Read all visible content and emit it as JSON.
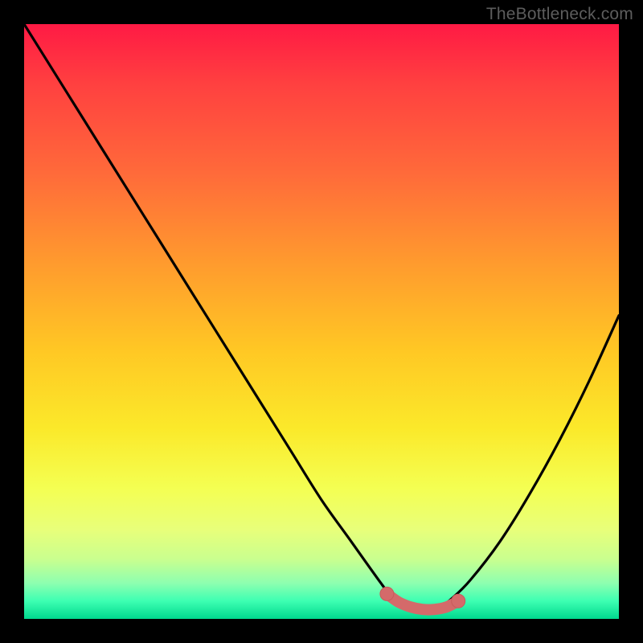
{
  "watermark": "TheBottleneck.com",
  "colors": {
    "curve": "#000000",
    "marker_fill": "#d46a6a",
    "marker_stroke": "#c85a5a",
    "gradient_top": "#ff1a44",
    "gradient_bottom": "#00d88e",
    "frame": "#000000"
  },
  "chart_data": {
    "type": "line",
    "title": "",
    "xlabel": "",
    "ylabel": "",
    "xlim": [
      0,
      100
    ],
    "ylim": [
      0,
      100
    ],
    "series": [
      {
        "name": "bottleneck-curve",
        "x": [
          0,
          5,
          10,
          15,
          20,
          25,
          30,
          35,
          40,
          45,
          50,
          55,
          60,
          62,
          64,
          66,
          68,
          70,
          72,
          75,
          80,
          85,
          90,
          95,
          100
        ],
        "values": [
          100,
          92,
          84,
          76,
          68,
          60,
          52,
          44,
          36,
          28,
          20,
          13,
          6,
          3.5,
          2,
          1.5,
          1.5,
          2,
          3.5,
          6.5,
          13,
          21,
          30,
          40,
          51
        ]
      }
    ],
    "markers": {
      "name": "optimal-range",
      "x": [
        61,
        63,
        65,
        67,
        69,
        71,
        73
      ],
      "values": [
        4.2,
        2.8,
        2.0,
        1.6,
        1.6,
        2.0,
        3.0
      ]
    },
    "grid": false,
    "legend": false
  }
}
